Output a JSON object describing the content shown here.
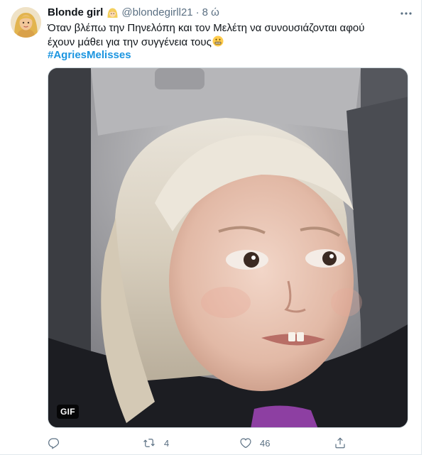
{
  "tweet": {
    "author": {
      "display_name": "Blonde girl",
      "name_emoji": "person-blond-hair-emoji",
      "handle": "@blondegirll21"
    },
    "separator": "·",
    "time": "8 ώ",
    "text_lines": [
      "Όταν βλέπω την Πηνελόπη και τον Μελέτη να συνουσιάζονται αφού",
      "έχουν μάθει για την συγγένεια τους"
    ],
    "text_emoji": "grinning-face-emoji",
    "hashtag": "#AgriesMelisses",
    "media": {
      "type": "gif",
      "badge": "GIF",
      "subject": "child-side-eye-gif"
    },
    "actions": {
      "reply": {
        "icon": "reply-icon",
        "count": ""
      },
      "retweet": {
        "icon": "retweet-icon",
        "count": "4"
      },
      "like": {
        "icon": "heart-icon",
        "count": "46"
      },
      "share": {
        "icon": "share-icon",
        "count": ""
      }
    }
  },
  "colors": {
    "text": "#0f1419",
    "secondary": "#5b7083",
    "link": "#1b95e0",
    "border": "#e1e8ed"
  }
}
